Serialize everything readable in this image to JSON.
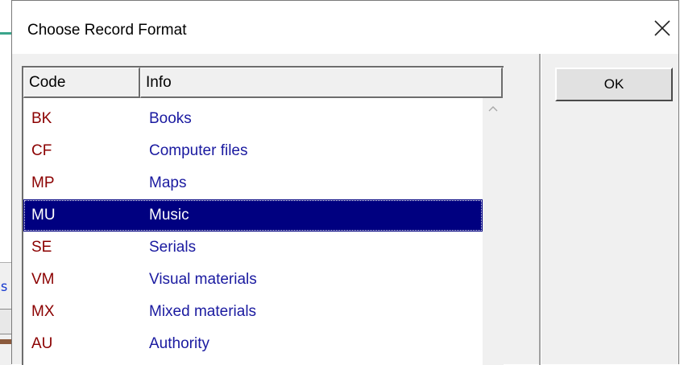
{
  "dialog": {
    "title": "Choose Record Format",
    "close_icon": "close-icon",
    "ok_label": "OK"
  },
  "list": {
    "columns": [
      "Code",
      "Info"
    ],
    "selected_code": "MU",
    "rows": [
      {
        "code": "BK",
        "info": "Books"
      },
      {
        "code": "CF",
        "info": "Computer files"
      },
      {
        "code": "MP",
        "info": "Maps"
      },
      {
        "code": "MU",
        "info": "Music"
      },
      {
        "code": "SE",
        "info": "Serials"
      },
      {
        "code": "VM",
        "info": "Visual materials"
      },
      {
        "code": "MX",
        "info": "Mixed materials"
      },
      {
        "code": "AU",
        "info": "Authority"
      }
    ]
  },
  "colors": {
    "code_text": "#8b0000",
    "info_text": "#1a1aa0",
    "selection": "#000080"
  },
  "background": {
    "partial_text": "s"
  }
}
